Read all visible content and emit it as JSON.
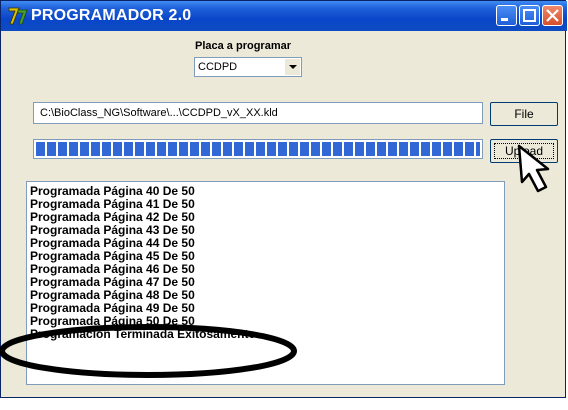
{
  "window": {
    "title": "PROGRAMADOR 2.0"
  },
  "board": {
    "label": "Placa a programar",
    "selected": "CCDPD"
  },
  "file": {
    "path": "C:\\BioClass_NG\\Software\\...\\CCDPD_vX_XX.kld",
    "button_label": "File"
  },
  "upload": {
    "button_label": "Upload"
  },
  "progress": {
    "value": 1.0
  },
  "log": {
    "lines": [
      "Programada Página 40 De 50",
      "Programada Página 41 De 50",
      "Programada Página 42 De 50",
      "Programada Página 43 De 50",
      "Programada Página 44 De 50",
      "Programada Página 45 De 50",
      "Programada Página 46 De 50",
      "Programada Página 47 De 50",
      "Programada Página 48 De 50",
      "Programada Página 49 De 50",
      "Programada Página 50 De 50",
      "Programación Terminada Exitosamente"
    ]
  },
  "colors": {
    "titlebar": "#0a46c9",
    "progress_fill": "#3168d5",
    "close_button": "#d54f2b"
  }
}
